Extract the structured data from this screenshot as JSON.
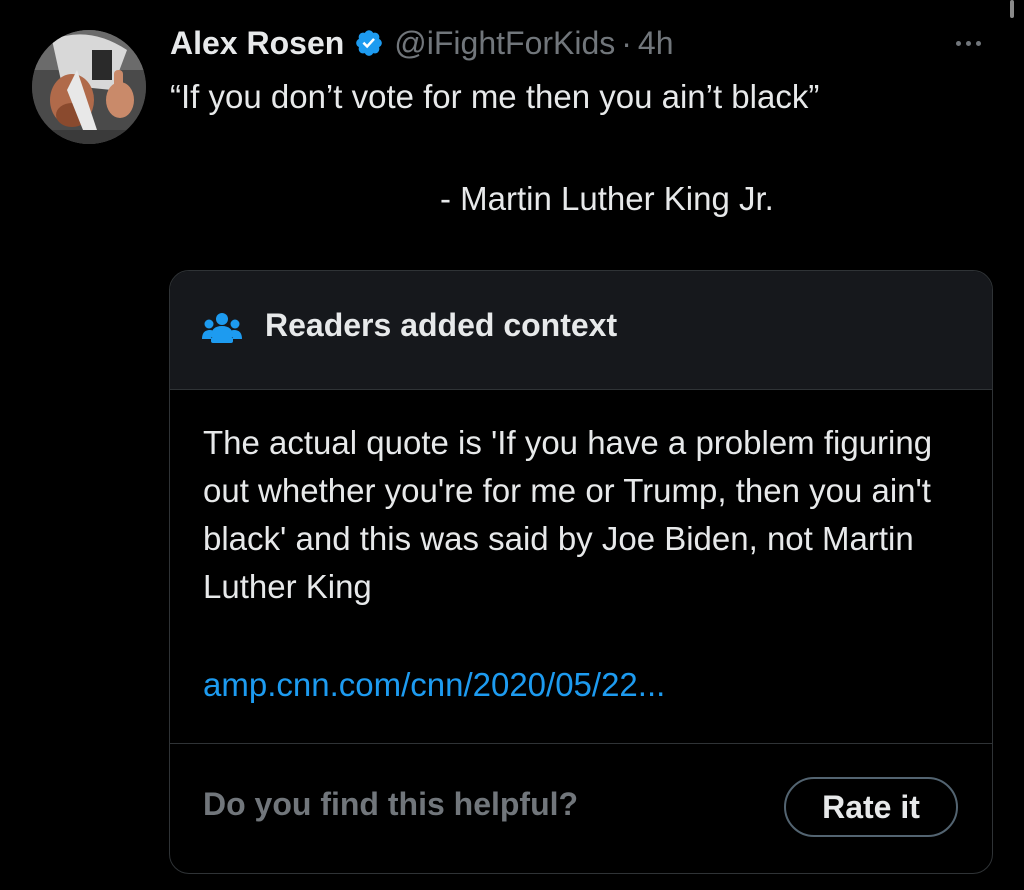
{
  "tweet": {
    "author": {
      "display_name": "Alex Rosen",
      "handle": "@iFightForKids",
      "verified": true,
      "avatar_icon": "avatar-photo"
    },
    "separator": "·",
    "time": "4h",
    "more_icon": "ellipsis-icon",
    "text": "“If you don’t vote for me then you ain’t black”",
    "attribution": "- Martin Luther King Jr."
  },
  "community_note": {
    "icon": "people-icon",
    "title": "Readers added context",
    "body": "The actual quote is 'If you have a problem figuring out whether you're for me or Trump, then you ain't black' and this was said by Joe Biden, not Martin Luther King",
    "link": "amp.cnn.com/cnn/2020/05/22...",
    "prompt": "Do you find this helpful?",
    "rate_button_label": "Rate it"
  },
  "colors": {
    "background": "#000000",
    "text_primary": "#e7e9ea",
    "text_secondary": "#71767b",
    "accent": "#1d9bf0",
    "note_header_bg": "#16181c",
    "border": "#2f3336"
  }
}
